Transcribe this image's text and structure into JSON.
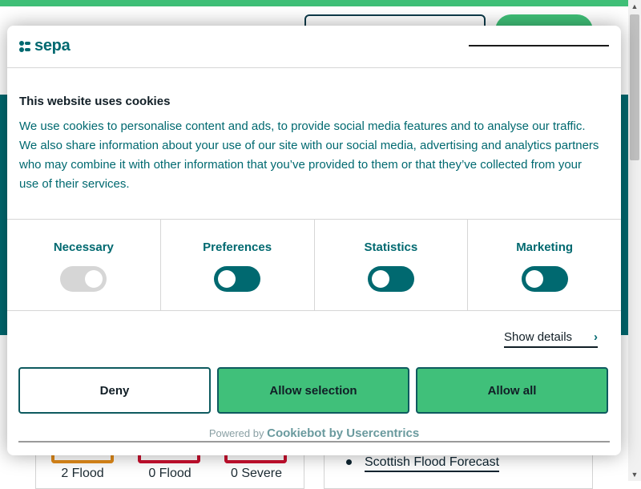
{
  "background": {
    "flood_stats": [
      "2 Flood",
      "0 Flood",
      "0 Severe"
    ],
    "forecast_link": "Scottish Flood Forecast"
  },
  "dialog": {
    "logo_text": "sepa",
    "title": "This website uses cookies",
    "body": "We use cookies to personalise content and ads, to provide social media features and to analyse our traffic. We also share information about your use of our site with our social media, advertising and analytics partners who may combine it with other information that you’ve provided to them or that they’ve collected from your use of their services.",
    "consents": [
      {
        "label": "Necessary",
        "enabled": true,
        "disabled": true
      },
      {
        "label": "Preferences",
        "enabled": false
      },
      {
        "label": "Statistics",
        "enabled": false
      },
      {
        "label": "Marketing",
        "enabled": false
      }
    ],
    "show_details": "Show details",
    "buttons": {
      "deny": "Deny",
      "allow_selection": "Allow selection",
      "allow_all": "Allow all"
    },
    "powered_by": "Powered by",
    "powered_brand": "Cookiebot by Usercentrics"
  },
  "colors": {
    "brand_teal": "#006970",
    "accent_green": "#40c07a",
    "text_dark": "#111e26"
  }
}
